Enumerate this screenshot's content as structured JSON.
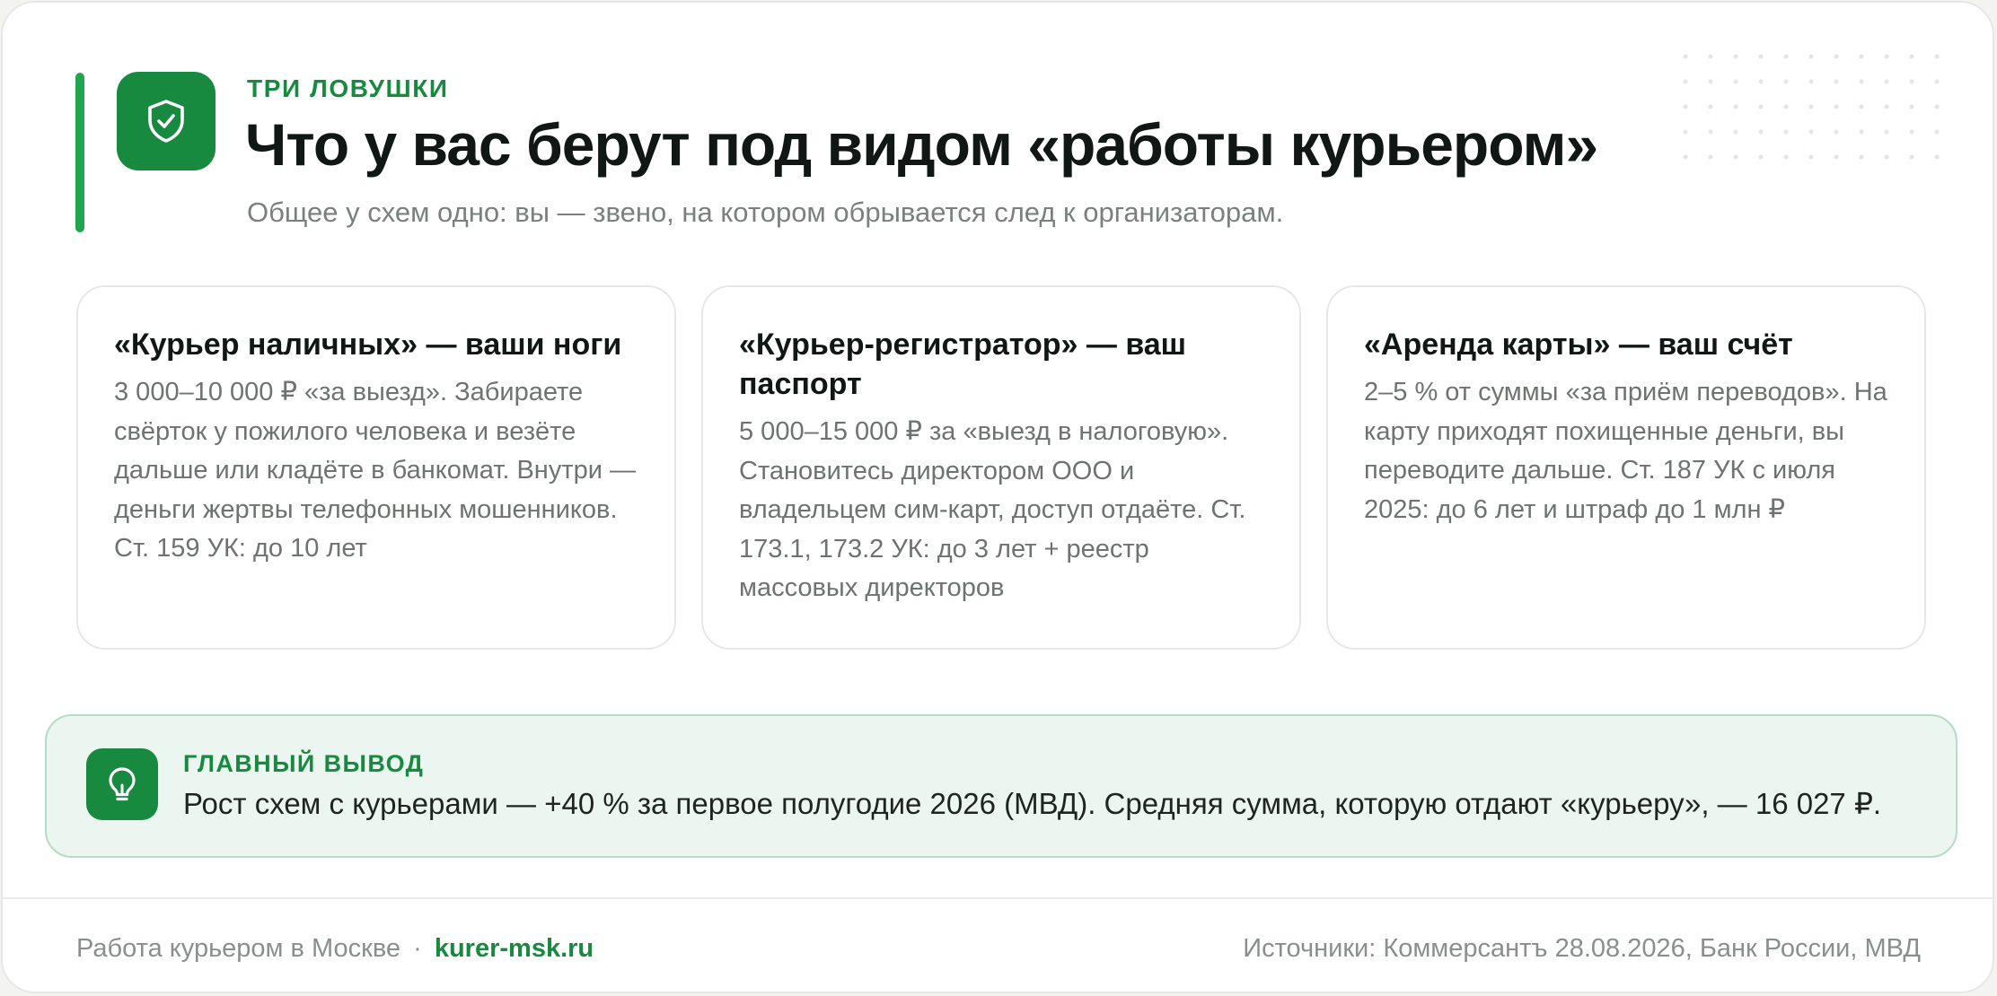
{
  "header": {
    "eyebrow": "ТРИ ЛОВУШКИ",
    "title": "Что у вас берут под видом «работы курьером»",
    "subtitle": "Общее у схем одно: вы — звено, на котором обрывается след к организаторам."
  },
  "schemes": [
    {
      "title": "«Курьер наличных» — ваши ноги",
      "body": "3 000–10 000 ₽ «за выезд». Забираете свёрток у пожилого человека и везёте дальше или кладёте в банкомат. Внутри — деньги жертвы телефонных мошенников. Ст. 159 УК: до 10 лет"
    },
    {
      "title": "«Курьер-регистратор» — ваш паспорт",
      "body": "5 000–15 000 ₽ за «выезд в налоговую». Становитесь директором ООО и владельцем сим-карт, доступ отдаёте. Ст. 173.1, 173.2 УК: до 3 лет + реестр массовых директоров"
    },
    {
      "title": "«Аренда карты» — ваш счёт",
      "body": "2–5 % от суммы «за приём переводов». На карту приходят похищенные деньги, вы переводите дальше. Ст. 187 УК с июля 2025: до 6 лет и штраф до 1 млн ₽"
    }
  ],
  "takeaway": {
    "label": "ГЛАВНЫЙ ВЫВОД",
    "text": "Рост схем с курьерами — +40 % за первое полугодие 2026 (МВД). Средняя сумма, которую отдают «курьеру», — 16 027 ₽."
  },
  "footer": {
    "left_text": "Работа курьером в Москве",
    "separator": "·",
    "link": "kurer-msk.ru",
    "sources": "Источники: Коммерсантъ 28.08.2026, Банк России, МВД"
  },
  "colors": {
    "accent": "#178a3f",
    "accent_bar": "#22a550",
    "takeaway_bg": "#eaf6ef"
  },
  "icons": {
    "header": "shield-check-icon",
    "takeaway": "lightbulb-icon"
  }
}
